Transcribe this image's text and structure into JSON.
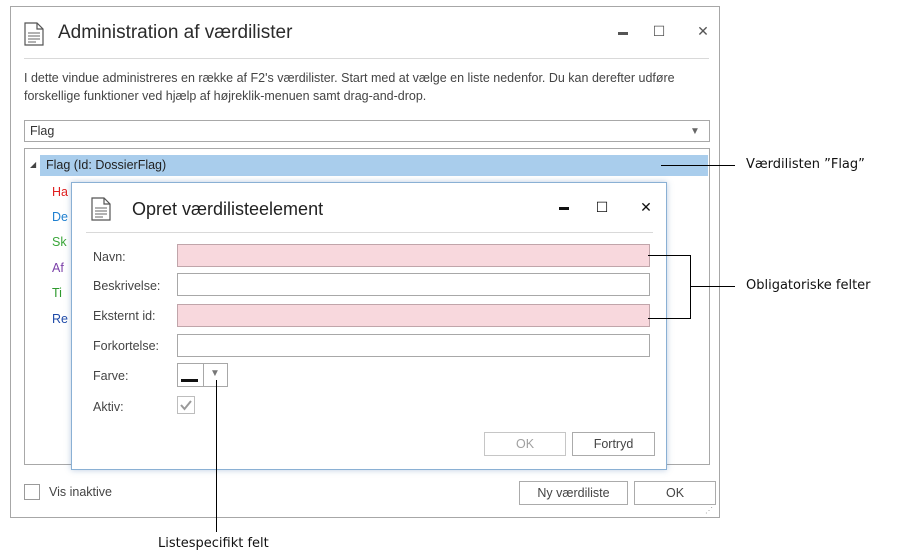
{
  "main": {
    "title": "Administration af værdilister",
    "title_icon": "document-icon",
    "controls": {
      "minimize": "▬",
      "maximize": "☐",
      "close": "✕"
    },
    "description": "I dette vindue administreres en række af F2's værdilister. Start med at vælge en liste nedenfor. Du kan derefter udføre forskellige funktioner ved hjælp af højreklik-menuen samt drag-and-drop.",
    "list_select": {
      "value": "Flag"
    },
    "tree": {
      "root": "Flag (Id: DossierFlag)",
      "items": [
        {
          "text": "Ha",
          "color": "#e02020"
        },
        {
          "text": "De",
          "color": "#1e7fd0"
        },
        {
          "text": "Sk",
          "color": "#3aa63a"
        },
        {
          "text": "Af",
          "color": "#7a3fa8"
        },
        {
          "text": "Ti",
          "color": "#2e9a2e"
        },
        {
          "text": "Re",
          "color": "#1f4aa8"
        }
      ]
    },
    "show_inactive_label": "Vis inaktive",
    "new_list_button": "Ny værdiliste",
    "ok_button": "OK"
  },
  "dialog": {
    "title": "Opret værdilisteelement",
    "title_icon": "document-icon",
    "controls": {
      "minimize": "▬",
      "maximize": "☐",
      "close": "✕"
    },
    "fields": {
      "name_label": "Navn:",
      "description_label": "Beskrivelse:",
      "external_id_label": "Eksternt id:",
      "abbreviation_label": "Forkortelse:",
      "color_label": "Farve:",
      "active_label": "Aktiv:"
    },
    "ok_button": "OK",
    "cancel_button": "Fortryd"
  },
  "annotations": {
    "value_list": "Værdilisten ”Flag”",
    "required_fields": "Obligatoriske felter",
    "list_specific": "Listespecifikt felt"
  },
  "colors": {
    "selection": "#a9cdec",
    "required_field": "#f8d8dd"
  }
}
